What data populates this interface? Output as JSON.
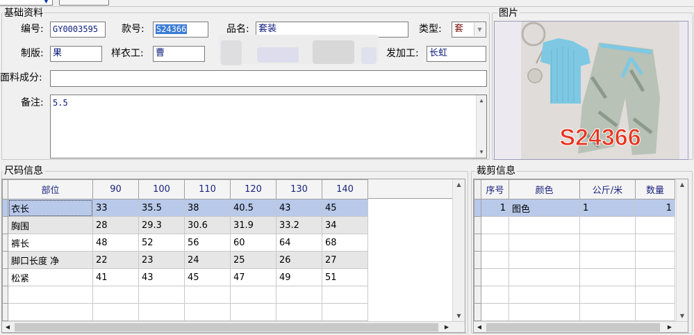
{
  "basic": {
    "title": "基础资料",
    "code_label": "编号:",
    "code_value": "GY0003595",
    "style_label": "款号:",
    "style_value": "S24366",
    "name_label": "品名:",
    "name_value": "套装",
    "type_label": "类型:",
    "type_value": "套",
    "pattern_label": "制版:",
    "pattern_value": "果",
    "sample_label": "样衣工:",
    "sample_value": "曹",
    "processor_label": "发加工:",
    "processor_value": "长虹",
    "fabric_label": "面料成分:",
    "fabric_value": "",
    "remark_label": "备注:",
    "remark_value": "5.5"
  },
  "picture": {
    "title": "图片",
    "overlay_text": "S24366"
  },
  "size_info": {
    "title": "尺码信息",
    "columns": [
      "部位",
      "90",
      "100",
      "110",
      "120",
      "130",
      "140"
    ],
    "rows": [
      [
        "衣长",
        "33",
        "35.5",
        "38",
        "40.5",
        "43",
        "45"
      ],
      [
        "胸围",
        "28",
        "29.3",
        "30.6",
        "31.9",
        "33.2",
        "34"
      ],
      [
        "裤长",
        "48",
        "52",
        "56",
        "60",
        "64",
        "68"
      ],
      [
        "脚口长度 净",
        "22",
        "23",
        "24",
        "25",
        "26",
        "27"
      ],
      [
        "松紧",
        "41",
        "43",
        "45",
        "47",
        "49",
        "51"
      ]
    ]
  },
  "cut_info": {
    "title": "裁剪信息",
    "columns": [
      "序号",
      "颜色",
      "公斤/米",
      "数量"
    ],
    "rows": [
      [
        "1",
        "图色",
        "1",
        "1"
      ]
    ]
  },
  "colors": {
    "selection": "#b8c9ea",
    "header_text": "#1a237e",
    "overlay_red": "#e8341f",
    "shirt_blue": "#7ec8e3"
  },
  "icons": {
    "combo_arrow": "chevron-down-icon",
    "scroll_up": "triangle-up-icon",
    "scroll_down": "triangle-down-icon",
    "scroll_left": "triangle-left-icon",
    "scroll_right": "triangle-right-icon"
  }
}
